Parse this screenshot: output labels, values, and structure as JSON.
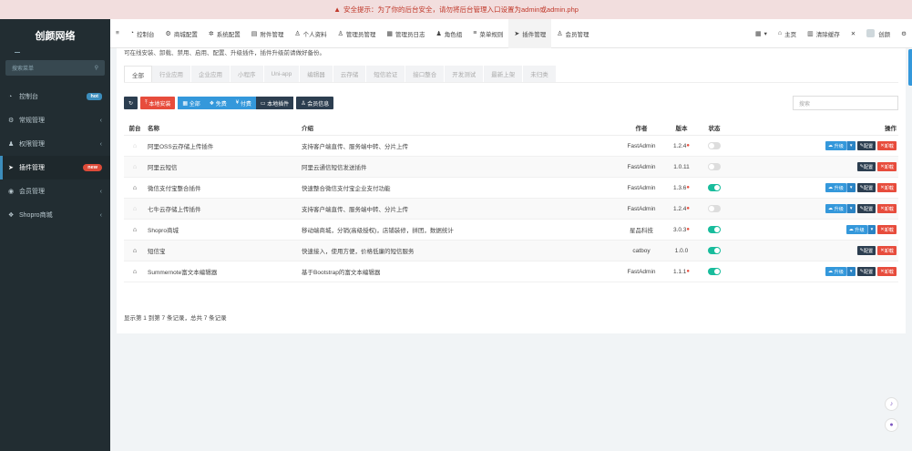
{
  "alert": {
    "icon": "warning-icon",
    "text": "安全提示：为了你的后台安全，请勿将后台管理入口设置为admin或admin.php"
  },
  "brand": {
    "title": "创颜网络"
  },
  "sidebar": {
    "search_placeholder": "搜索菜单",
    "items": [
      {
        "icon": "dashboard-icon",
        "label": "控制台",
        "badge": "hot"
      },
      {
        "icon": "cogs-icon",
        "label": "常规管理",
        "chevron": "‹"
      },
      {
        "icon": "group-icon",
        "label": "权限管理",
        "chevron": "‹"
      },
      {
        "icon": "rocket-icon",
        "label": "插件管理",
        "badge": "new"
      },
      {
        "icon": "user-circle-icon",
        "label": "会员管理",
        "chevron": "‹"
      },
      {
        "icon": "gift-icon",
        "label": "Shopro商城",
        "chevron": "‹"
      }
    ]
  },
  "topnav": {
    "menu_icon": "≡",
    "items": [
      {
        "icon": "dashboard-icon",
        "label": "控制台"
      },
      {
        "icon": "cogs-icon",
        "label": "商城配置"
      },
      {
        "icon": "gear-icon",
        "label": "系统配置"
      },
      {
        "icon": "file-icon",
        "label": "附件管理"
      },
      {
        "icon": "user-icon",
        "label": "个人资料"
      },
      {
        "icon": "user-icon",
        "label": "管理员管理"
      },
      {
        "icon": "list-icon",
        "label": "管理员日志"
      },
      {
        "icon": "group-icon",
        "label": "角色组"
      },
      {
        "icon": "bars-icon",
        "label": "菜单规则"
      },
      {
        "icon": "rocket-icon",
        "label": "插件管理"
      },
      {
        "icon": "user-icon",
        "label": "会员管理"
      }
    ],
    "right": {
      "more_label": "▾",
      "home_label": "主页",
      "clear_cache_label": "清除缓存",
      "fullscreen_icon": "expand-icon",
      "user_name": "创颜",
      "settings_icon": "cogs-icon"
    }
  },
  "page": {
    "tip": "可在线安装、卸载、禁用、启用、配置、升级插件，插件升级前请做好备份。",
    "tabs": [
      "全部",
      "行业应用",
      "企业应用",
      "小程序",
      "Uni-app",
      "编辑器",
      "云存储",
      "短信验证",
      "接口整合",
      "开发测试",
      "最新上架",
      "未归类"
    ],
    "toolbar": {
      "refresh_label": "↻",
      "local_install_label": "本地安装",
      "all_label": "全部",
      "free_label": "免费",
      "paid_label": "付费",
      "local_addons_label": "本地插件",
      "member_info_label": "会员信息"
    },
    "search_placeholder": "搜索"
  },
  "table": {
    "headers": {
      "frontend": "前台",
      "name": "名称",
      "intro": "介绍",
      "author": "作者",
      "version": "版本",
      "state": "状态",
      "operate": "操作"
    },
    "rows": [
      {
        "frontend": false,
        "name": "阿里OSS云存储上传插件",
        "intro": "支持客户端直传、服务端中转、分片上传",
        "author": "FastAdmin",
        "version": "1.2.4",
        "upgrade_dot": true,
        "enabled": false,
        "ops": [
          "upgrade",
          "config",
          "uninstall"
        ]
      },
      {
        "frontend": false,
        "name": "阿里云短信",
        "intro": "阿里云通信短信发送插件",
        "author": "FastAdmin",
        "version": "1.0.11",
        "upgrade_dot": false,
        "enabled": false,
        "ops": [
          "config",
          "uninstall"
        ]
      },
      {
        "frontend": true,
        "name": "微信支付宝整合插件",
        "intro": "快速整合微信支付宝企业支付功能",
        "author": "FastAdmin",
        "version": "1.3.6",
        "upgrade_dot": true,
        "enabled": true,
        "ops": [
          "upgrade",
          "config",
          "uninstall"
        ]
      },
      {
        "frontend": false,
        "name": "七牛云存储上传插件",
        "intro": "支持客户端直传、服务端中转、分片上传",
        "author": "FastAdmin",
        "version": "1.2.4",
        "upgrade_dot": true,
        "enabled": false,
        "ops": [
          "upgrade",
          "config",
          "uninstall"
        ]
      },
      {
        "frontend": true,
        "name": "Shopro商城",
        "intro": "移动端商城，分销(高级授权)，店铺装修，拼团，数据统计",
        "author": "星品科技",
        "version": "3.0.3",
        "upgrade_dot": true,
        "enabled": true,
        "ops": [
          "upgrade",
          "uninstall"
        ]
      },
      {
        "frontend": true,
        "name": "短信宝",
        "intro": "快速接入，使用方便，价格低廉的短信服务",
        "author": "catboy",
        "version": "1.0.0",
        "upgrade_dot": false,
        "enabled": true,
        "ops": [
          "config",
          "uninstall"
        ]
      },
      {
        "frontend": true,
        "name": "Summernote富文本编辑器",
        "intro": "基于Bootstrap的富文本编辑器",
        "author": "FastAdmin",
        "version": "1.1.1",
        "upgrade_dot": true,
        "enabled": true,
        "ops": [
          "upgrade",
          "config",
          "uninstall"
        ]
      }
    ],
    "op_labels": {
      "upgrade": "升级",
      "config": "配置",
      "uninstall": "卸载"
    }
  },
  "pagination": {
    "summary": "显示第 1 到第 7 条记录，总共 7 条记录"
  },
  "colors": {
    "primary": "#3498db",
    "danger": "#e74c3c",
    "success": "#18bc9c",
    "dark": "#2c3e50",
    "sidebar": "#222d32"
  }
}
